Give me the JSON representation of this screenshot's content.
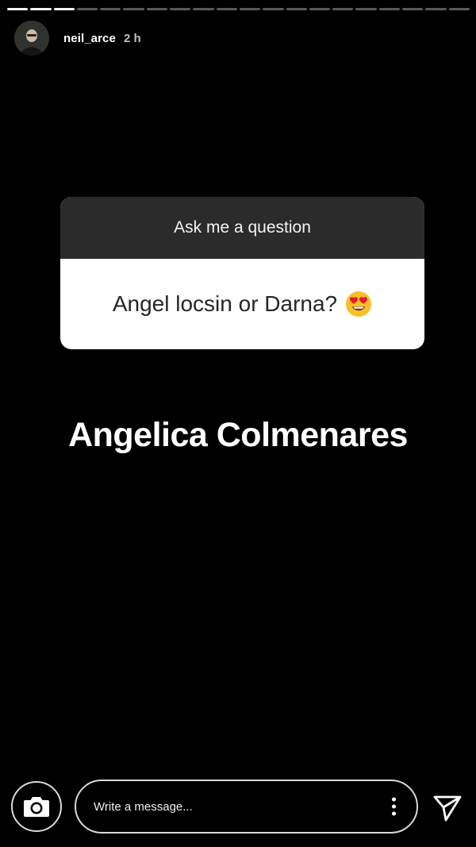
{
  "story": {
    "segments_total": 20,
    "segments_completed": 3,
    "username": "neil_arce",
    "time_ago": "2 h"
  },
  "question_sticker": {
    "title": "Ask me a question",
    "question": "Angel locsin or Darna?",
    "emoji": "heart-eyes-emoji"
  },
  "caption": "Angelica Colmenares",
  "footer": {
    "camera_icon": "camera-icon",
    "message_placeholder": "Write a message...",
    "more_icon": "more-vertical-icon",
    "send_icon": "send-icon"
  },
  "colors": {
    "background": "#000000",
    "sticker_header": "#2b2b2b",
    "sticker_body": "#ffffff",
    "emoji_face": "#f7c02a",
    "emoji_heart": "#e8192c"
  }
}
